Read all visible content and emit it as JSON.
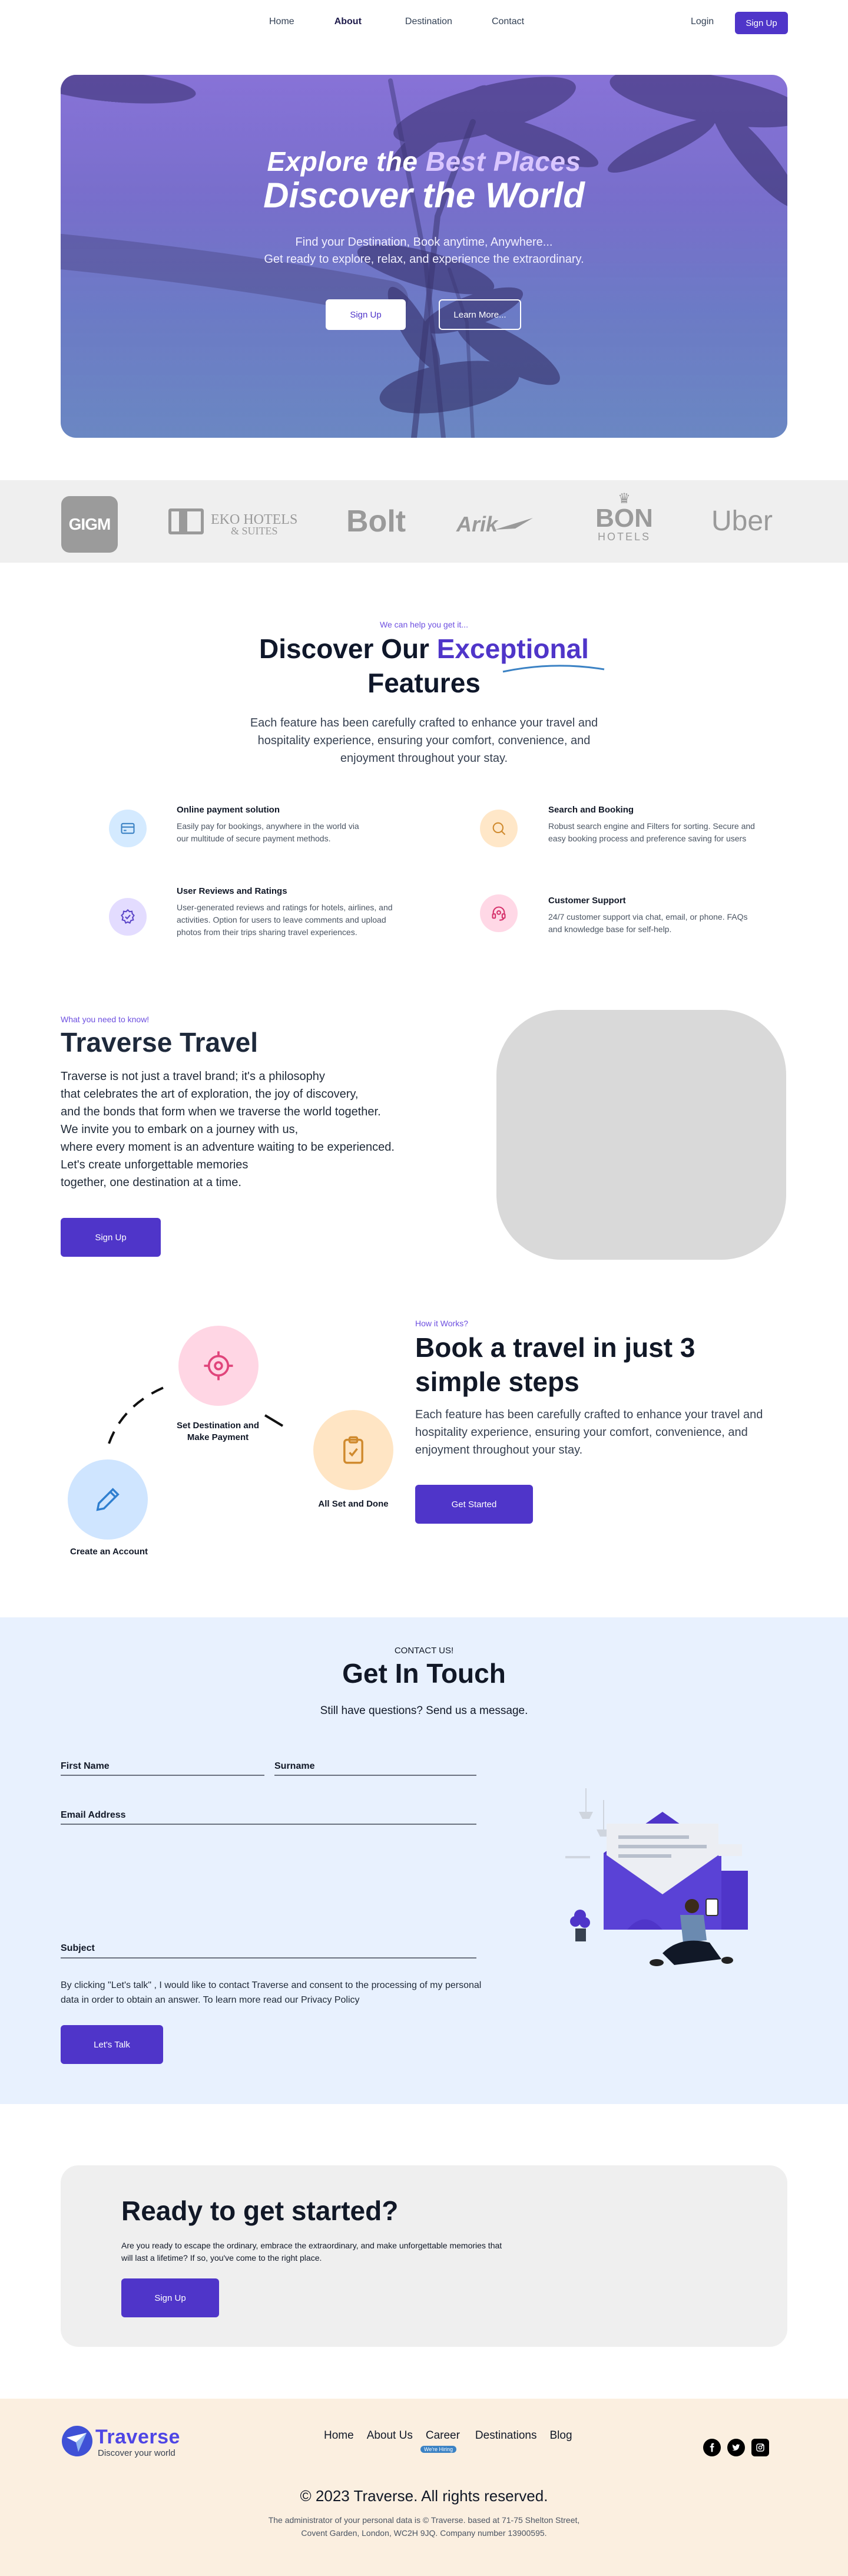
{
  "nav": {
    "links": [
      {
        "label": "Home",
        "active": false
      },
      {
        "label": "About",
        "active": true
      },
      {
        "label": "Destination",
        "active": false
      },
      {
        "label": "Contact",
        "active": false
      }
    ],
    "login_label": "Login",
    "signup_label": "Sign Up"
  },
  "hero": {
    "line1_prefix": "Explore the ",
    "line1_accent": "Best Places",
    "line2": "Discover the World",
    "sub1": "Find your Destination, Book anytime, Anywhere...",
    "sub2": "Get ready to explore, relax, and experience the extraordinary.",
    "primary_button": "Sign Up",
    "secondary_button": "Learn More..."
  },
  "partners": {
    "gigm": "GIGM",
    "eko": "EKO HOTELS",
    "eko_sub": "& SUITES",
    "bolt": "Bolt",
    "arik": "Arik",
    "bon": "BON",
    "bon_sub": "HOTELS",
    "uber": "Uber"
  },
  "features": {
    "pretitle": "We can help you get it...",
    "title_prefix": "Discover Our ",
    "title_accent": "Exceptional",
    "title_line2": "Features",
    "description": "Each feature has been carefully crafted to enhance your travel and hospitality experience, ensuring your comfort, convenience, and enjoyment throughout your stay.",
    "items": [
      {
        "title": "Online payment solution",
        "desc": "Easily pay for bookings, anywhere in the world via our multitude of secure payment methods.",
        "icon": "credit-card-icon"
      },
      {
        "title": "Search and Booking",
        "desc": "Robust search engine and Filters for sorting. Secure and easy booking process and preference saving for users",
        "icon": "search-icon"
      },
      {
        "title": "User Reviews and Ratings",
        "desc": "User-generated reviews and ratings for hotels, airlines, and activities. Option for users to leave comments and upload photos from their trips sharing travel experiences.",
        "icon": "verified-badge-icon"
      },
      {
        "title": "Customer Support",
        "desc": "24/7 customer support via chat, email, or phone. FAQs and knowledge base for self-help.",
        "icon": "headset-icon"
      }
    ]
  },
  "about": {
    "pretitle": "What you need to know!",
    "title": "Traverse Travel",
    "lines": [
      "Traverse is not just a travel brand; it's a philosophy",
      "that celebrates the art of exploration, the joy of discovery,",
      "and the bonds that form when we traverse the world together.",
      "We invite you to embark on a journey with us,",
      "where every moment is an adventure waiting to be experienced.",
      "Let's create unforgettable memories",
      "together, one destination at a time."
    ],
    "button": "Sign Up"
  },
  "steps": {
    "pretitle": "How it Works?",
    "title": "Book a travel in just 3 simple steps",
    "description": "Each feature has been carefully crafted to enhance your travel and hospitality experience, ensuring your comfort, convenience, and enjoyment throughout your stay.",
    "button": "Get Started",
    "items": [
      {
        "label": "Create an Account",
        "icon": "pencil-icon",
        "color": "#cfe5ff"
      },
      {
        "label": "Set Destination and Make Payment",
        "icon": "target-icon",
        "color": "#ffd6e4"
      },
      {
        "label": "All Set  and Done",
        "icon": "clipboard-check-icon",
        "color": "#ffe5c4"
      }
    ]
  },
  "contact": {
    "pretitle": "CONTACT US!",
    "title": "Get In Touch",
    "subtitle": "Still have questions? Send us a message.",
    "first_name_label": "First Name",
    "surname_label": "Surname",
    "email_label": "Email Address",
    "subject_label": "Subject",
    "consent": "By clicking \"Let's talk\" , I would like to contact Traverse and consent to the processing of my personal data in order to obtain an answer. To learn more read our Privacy Policy",
    "button": "Let's Talk"
  },
  "cta": {
    "title": "Ready to get started?",
    "description": "Are you ready to escape the ordinary, embrace the extraordinary, and make unforgettable memories that will last a lifetime? If so, you've come to the right place.",
    "button": "Sign Up"
  },
  "footer": {
    "brand": "Traverse",
    "tagline": "Discover your world",
    "links": [
      "Home",
      "About Us",
      "Career",
      "Destinations",
      "Blog"
    ],
    "career_badge": "We're Hiring",
    "social": [
      "facebook-icon",
      "twitter-icon",
      "instagram-icon"
    ],
    "copyright": "© 2023 Traverse. All rights reserved.",
    "admin_line1": "The administrator of your personal data is © Traverse. based at 71-75 Shelton Street,",
    "admin_line2": "Covent Garden, London, WC2H 9JQ. Company number 13900595."
  },
  "colors": {
    "brand": "#4f35c9",
    "accent_text": "#6d4fe0",
    "contact_bg": "#e8f1fe",
    "footer_bg": "#fbefe0"
  }
}
